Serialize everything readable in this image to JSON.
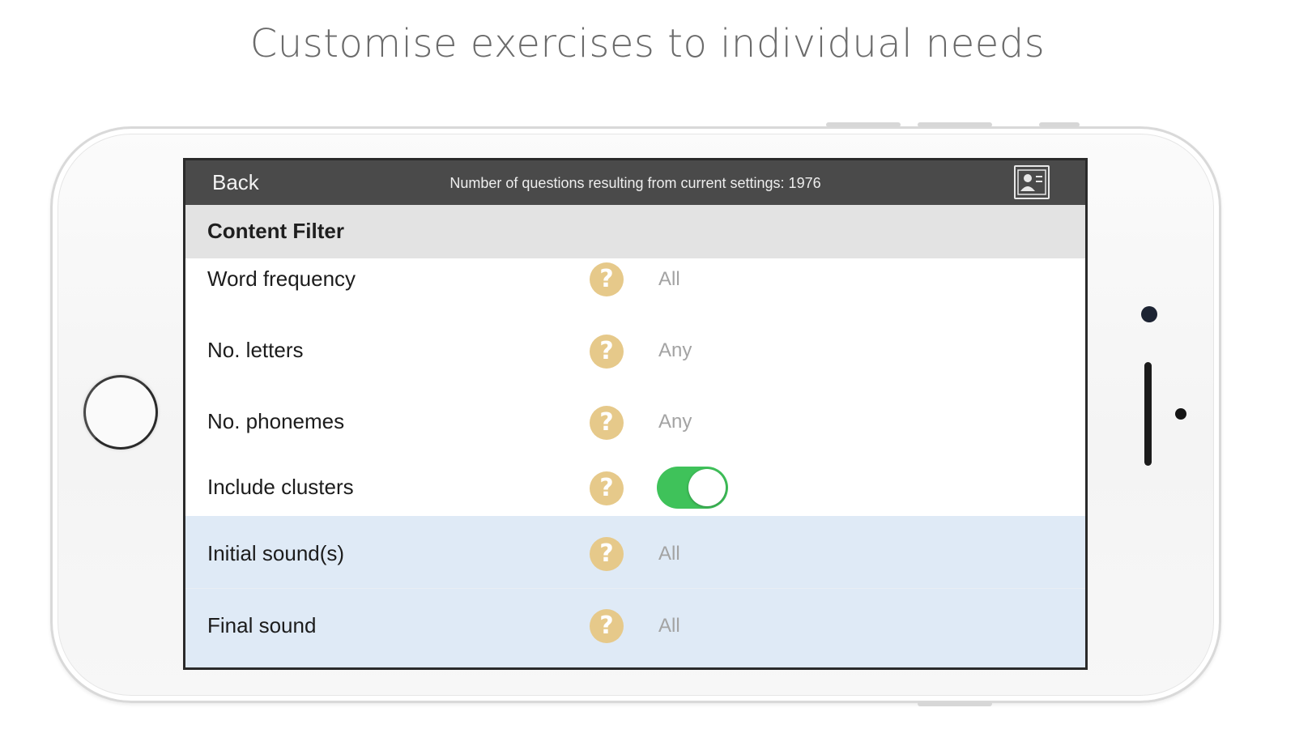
{
  "headline": "Customise exercises to individual needs",
  "navbar": {
    "back_label": "Back",
    "info_text": "Number of questions resulting from current settings: 1976",
    "icon": "profile-card-icon"
  },
  "section": {
    "title": "Content Filter"
  },
  "help_icon": {
    "glyph": "?",
    "color": "#e6c98a"
  },
  "rows": {
    "word_frequency": {
      "label": "Word frequency",
      "value": "All"
    },
    "no_letters": {
      "label": "No. letters",
      "value": "Any"
    },
    "no_phonemes": {
      "label": "No. phonemes",
      "value": "Any"
    },
    "include_clusters": {
      "label": "Include clusters",
      "toggle_on": true
    },
    "initial_sounds": {
      "label": "Initial sound(s)",
      "value": "All"
    },
    "final_sound": {
      "label": "Final sound",
      "value": "All"
    }
  },
  "colors": {
    "navbar": "#4a4a4a",
    "section_header": "#e3e3e3",
    "highlight_row": "#dfeaf6",
    "toggle_on": "#3fc25a"
  }
}
